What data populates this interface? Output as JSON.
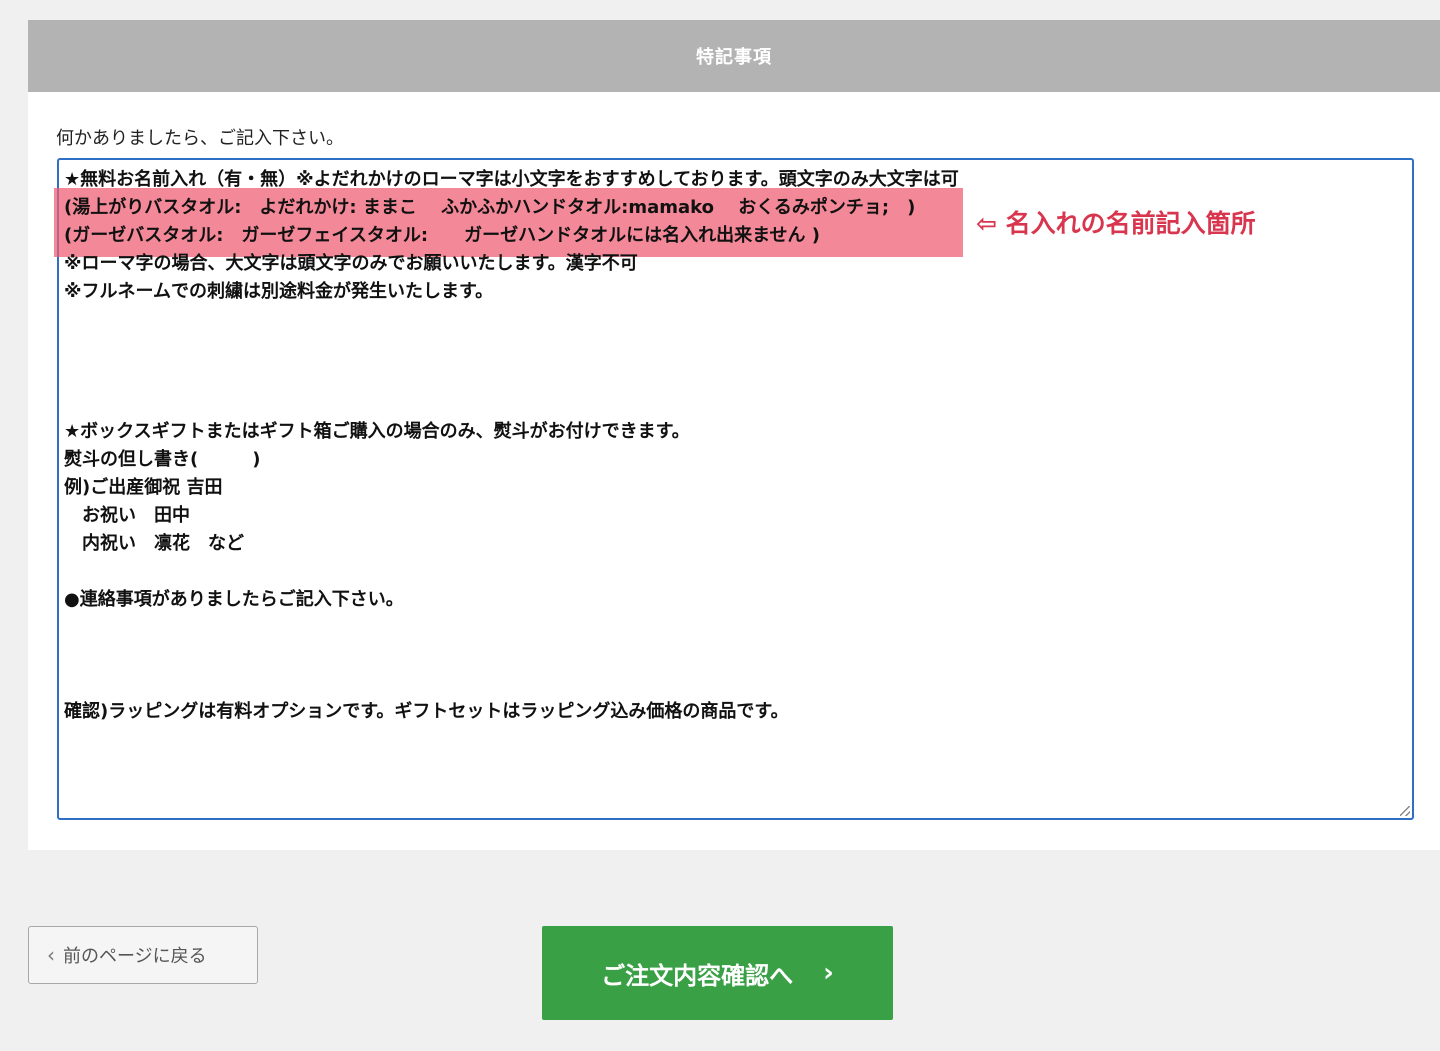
{
  "panel": {
    "title": "特記事項",
    "instruction": "何かありましたら、ご記入下さい。",
    "notes_value": "★無料お名前入れ（有・無）※よだれかけのローマ字は小文字をおすすめしております。頭文字のみ大文字は可\n(湯上がりバスタオル:　よだれかけ: ままこ　 ふかふかハンドタオル:mamako　 おくるみポンチョ;　)\n(ガーゼバスタオル:　ガーゼフェイスタオル:　　ガーゼハンドタオルには名入れ出来ません )\n※ローマ字の場合、大文字は頭文字のみでお願いいたします。漢字不可\n※フルネームでの刺繍は別途料金が発生いたします。\n\n\n\n\n★ボックスギフトまたはギフト箱ご購入の場合のみ、熨斗がお付けできます。\n熨斗の但し書き(　　　)\n例)ご出産御祝 吉田\n　お祝い　田中\n　内祝い　凛花　など\n\n●連絡事項がありましたらご記入下さい。\n\n\n\n確認)ラッピングは有料オプションです。ギフトセットはラッピング込み価格の商品です。"
  },
  "annotation": {
    "text": "⇦ 名入れの名前記入箇所",
    "highlight_color": "#ee5c70"
  },
  "buttons": {
    "back_label": "前のページに戻る",
    "confirm_label": "ご注文内容確認へ"
  },
  "colors": {
    "header_bg": "#b3b3b3",
    "textarea_border": "#2f6fc4",
    "confirm_bg": "#3aa046",
    "annotation_text": "#d8364f"
  },
  "icons": {
    "back": "chevron-left-icon",
    "confirm": "chevron-right-icon"
  }
}
